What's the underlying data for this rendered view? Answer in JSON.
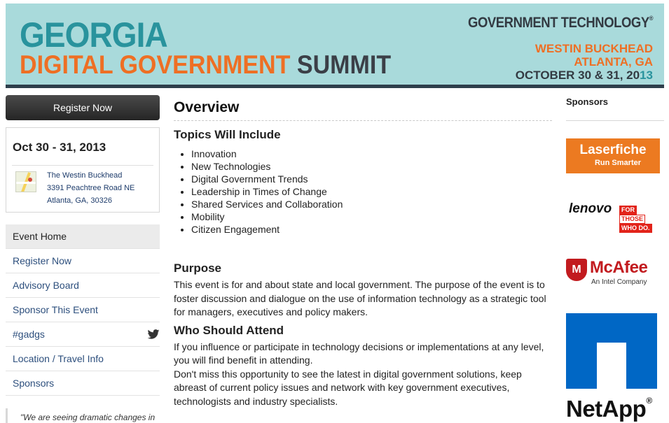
{
  "banner": {
    "title_line1": "GEORGIA",
    "title_line2_a": "DIGITAL GOVERNMENT",
    "title_line2_b": "SUMMIT",
    "publisher": "GOVERNMENT TECHNOLOGY",
    "venue_line1": "WESTIN BUCKHEAD",
    "venue_line2": "ATLANTA, GA",
    "venue_line3_a": "OCTOBER 30 & 31, 20",
    "venue_line3_b": "13",
    "colors": {
      "teal": "#29939d",
      "orange": "#ee6f24",
      "dark": "#3b3f47",
      "background": "#a9dadb"
    }
  },
  "sidebar": {
    "register_label": "Register Now",
    "dates": "Oct 30 - 31, 2013",
    "address": {
      "venue": "The Westin Buckhead",
      "street": "3391 Peachtree Road NE",
      "city": "Atlanta, GA, 30326"
    },
    "nav": [
      {
        "label": "Event Home",
        "active": true
      },
      {
        "label": "Register Now"
      },
      {
        "label": "Advisory Board"
      },
      {
        "label": "Sponsor This Event"
      },
      {
        "label": "#gadgs",
        "icon": "twitter-icon"
      },
      {
        "label": "Location / Travel Info"
      },
      {
        "label": "Sponsors"
      }
    ],
    "quote": "\"We are seeing dramatic changes in"
  },
  "main": {
    "title": "Overview",
    "topics_heading": "Topics Will Include",
    "topics": [
      "Innovation",
      "New Technologies",
      "Digital Government Trends",
      "Leadership in Times of Change",
      "Shared Services and Collaboration",
      "Mobility",
      "Citizen Engagement"
    ],
    "purpose_heading": "Purpose",
    "purpose_text": "This event is for and about state and local government. The purpose of the event is to foster discussion and dialogue on the use of information technology as a strategic tool for managers, executives and policy makers.",
    "who_heading": "Who Should Attend",
    "who_text_1": "If you influence or participate in technology decisions or implementations at any level, you will find benefit in attending.",
    "who_text_2": "Don't miss this opportunity to see the latest in digital government solutions, keep abreast of current policy issues and network with key government executives, technologists and industry specialists."
  },
  "sponsors": {
    "title": "Sponsors",
    "laserfiche": {
      "name": "Laserfiche",
      "tagline": "Run Smarter"
    },
    "lenovo": {
      "name": "lenovo",
      "tag1": "FOR",
      "tag2": "THOSE",
      "tag3": "WHO DO."
    },
    "mcafee": {
      "name": "McAfee",
      "tagline": "An Intel Company"
    },
    "netapp": {
      "name": "NetApp"
    }
  }
}
